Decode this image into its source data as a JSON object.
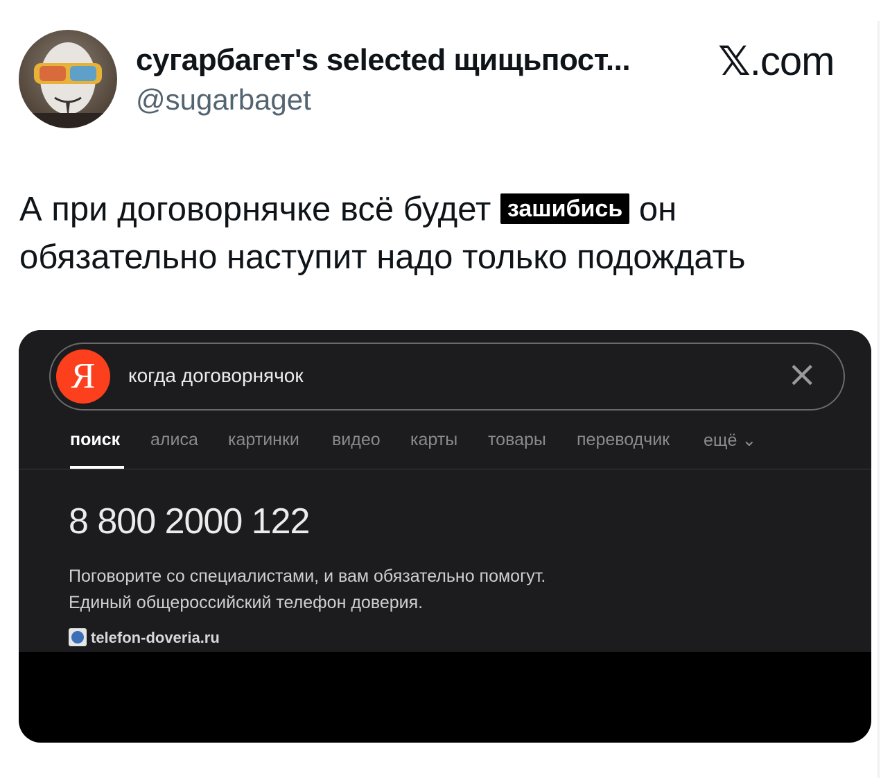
{
  "tweet": {
    "author_name": "сугарбагет's selected щищьпост...",
    "author_handle": "@sugarbaget",
    "brand_symbol": "𝕏",
    "brand_suffix": ".com",
    "text_before": "А при договорнячке всё будет ",
    "redacted_word": "зашибись",
    "text_after": " он обязательно наступит надо только подождать"
  },
  "screenshot": {
    "search": {
      "logo": "Я",
      "query": "когда договорнячок",
      "close_icon": "close-icon"
    },
    "tabs": [
      {
        "label": "поиск",
        "active": true
      },
      {
        "label": "алиса"
      },
      {
        "label": "картинки"
      },
      {
        "label": "видео"
      },
      {
        "label": "карты"
      },
      {
        "label": "товары"
      },
      {
        "label": "переводчик"
      },
      {
        "label": "ещё ⌄"
      }
    ],
    "result": {
      "phone": "8 800 2000 122",
      "description_line1": "Поговорите со специалистами, и вам обязательно помогут.",
      "description_line2": "Единый общероссийский телефон доверия.",
      "site": "telefon-doveria.ru"
    }
  },
  "colors": {
    "yandex_red": "#fc3f1d",
    "dark_bg": "#1c1c1e",
    "handle_gray": "#536471"
  }
}
